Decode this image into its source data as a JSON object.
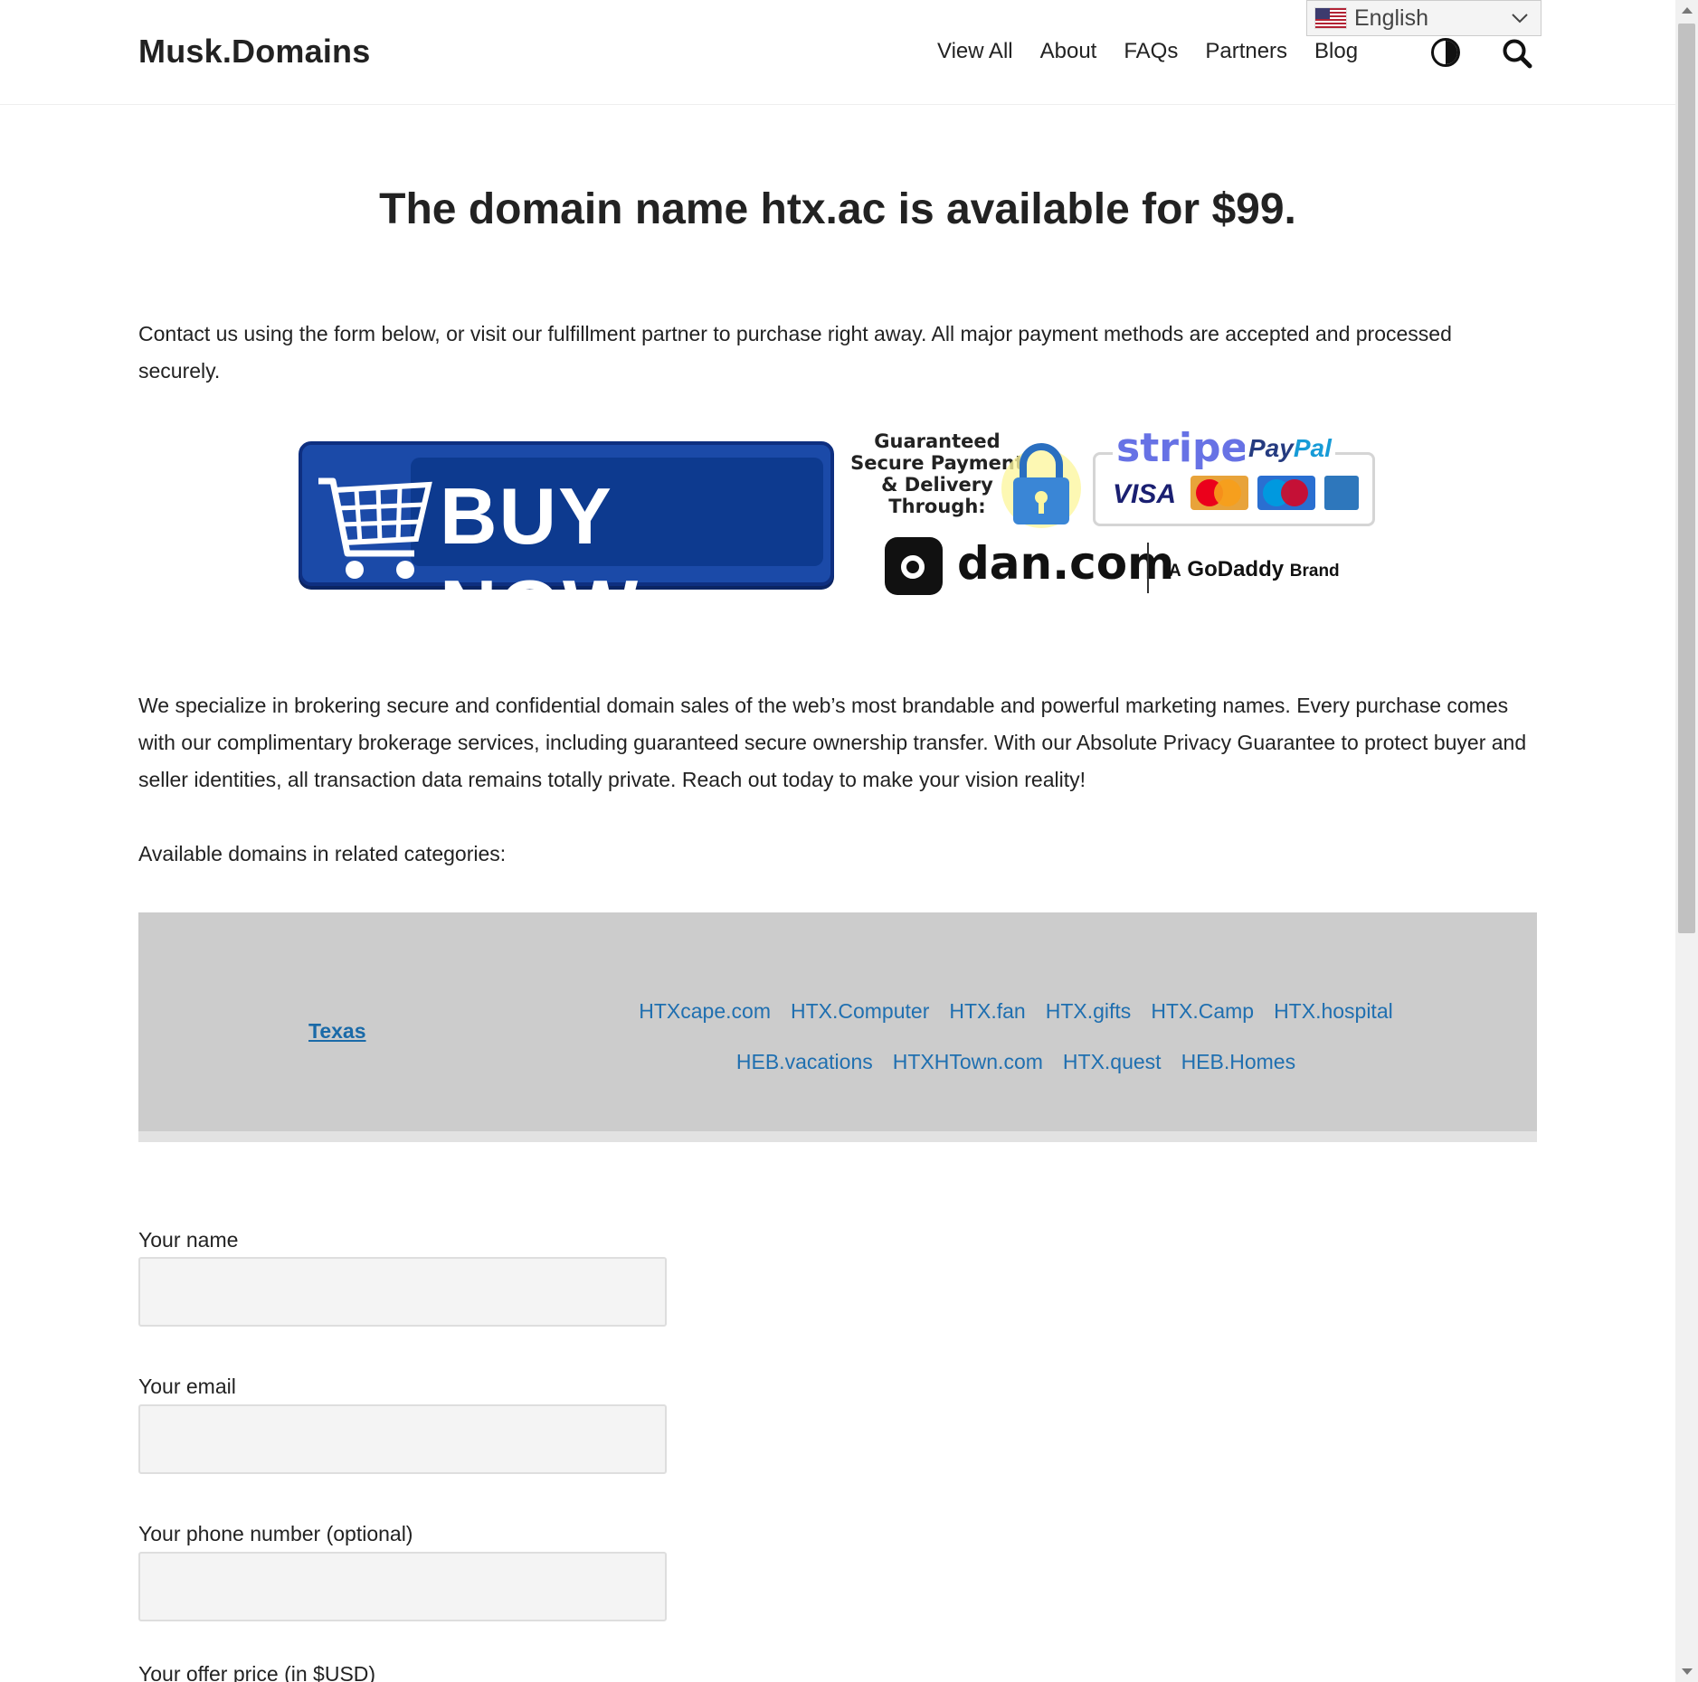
{
  "header": {
    "logo": "Musk.Domains",
    "nav": [
      "View All",
      "About",
      "FAQs",
      "Partners",
      "Blog"
    ],
    "theme_toggle_icon": "half-circle-icon",
    "search_icon": "search-icon",
    "language": "English"
  },
  "main": {
    "headline": "The domain name htx.ac is available for $99.",
    "intro": "Contact us using the form below, or visit our fulfillment partner to purchase right away. All major payment methods are accepted and processed securely.",
    "banner": {
      "buy_now": "BUY NOW",
      "guarantee": "Guaranteed Secure Payment & Delivery Through:",
      "stripe": "stripe",
      "paypal_pay": "Pay",
      "paypal_pal": "Pal",
      "visa": "VISA",
      "dan": "dan.com",
      "godaddy_prefix": "A",
      "godaddy": "GoDaddy",
      "godaddy_suffix": "Brand"
    },
    "description": "We specialize in brokering secure and confidential domain sales of the web’s most brandable and powerful marketing names. Every purchase comes with our complimentary brokerage services, including guaranteed secure ownership transfer. With our Absolute Privacy Guarantee to protect buyer and seller identities, all transaction data remains totally private. Reach out today to make your vision reality!",
    "related_heading": "Available domains in related categories:",
    "category": "Texas",
    "domains": [
      "HTXcape.com",
      "HTX.Computer",
      "HTX.fan",
      "HTX.gifts",
      "HTX.Camp",
      "HTX.hospital",
      "HEB.vacations",
      "HTXHTown.com",
      "HTX.quest",
      "HEB.Homes"
    ]
  },
  "form": {
    "name_label": "Your name",
    "email_label": "Your email",
    "phone_label": "Your phone number (optional)",
    "offer_label": "Your offer price (in $USD)"
  },
  "colors": {
    "link": "#1f6fb0",
    "category_bg": "#cccccc",
    "buy_button": "#1b4aa8"
  }
}
